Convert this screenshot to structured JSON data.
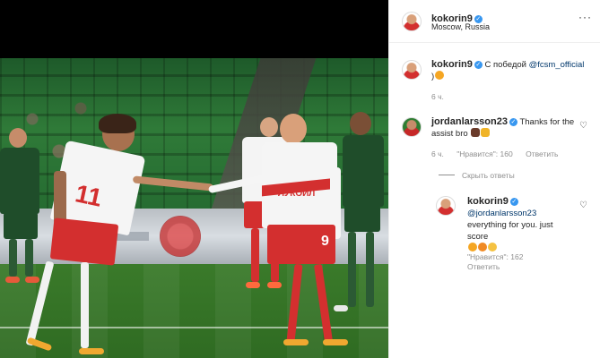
{
  "post": {
    "author": "kokorin9",
    "location": "Moscow, Russia",
    "more_icon": "ellipsis-icon"
  },
  "caption": {
    "username": "kokorin9",
    "text": "С победой",
    "mention": "@fcsm_official",
    "trailing": ")",
    "time": "6 ч."
  },
  "comment": {
    "username": "jordanlarsson23",
    "text": "Thanks for the assist bro",
    "time": "6 ч.",
    "likes": "\"Нравится\": 160",
    "reply_label": "Ответить",
    "hide_replies": "Скрыть ответы"
  },
  "reply": {
    "username": "kokorin9",
    "mention": "@jordanlarsson23",
    "text": "everything for you. just score",
    "likes": "\"Нравится\": 162",
    "reply_label": "Ответить"
  },
  "photo": {
    "jersey_left": "11",
    "jersey_right": "9",
    "sponsor": "ЛУКОЙЛ"
  },
  "colors": {
    "verified": "#3897f0",
    "meta_gray": "#8e8e8e",
    "mention_blue": "#00376b",
    "spartak_red": "#d32f2f"
  }
}
